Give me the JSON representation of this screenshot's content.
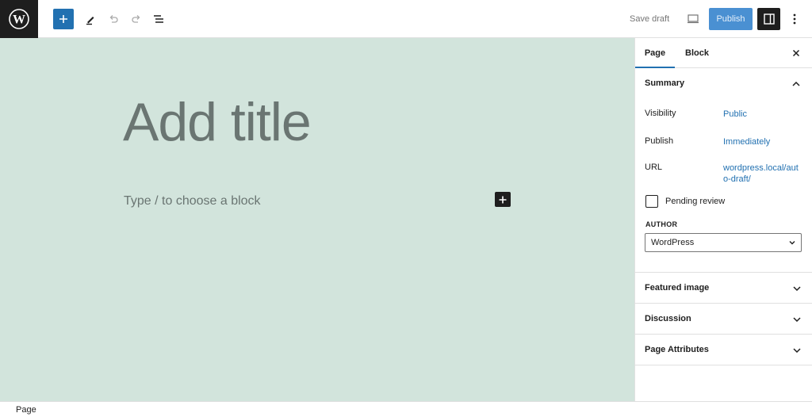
{
  "toolbar": {
    "add_block_label": "+",
    "save_draft": "Save draft",
    "publish": "Publish"
  },
  "editor": {
    "title_placeholder": "Add title",
    "block_placeholder": "Type / to choose a block"
  },
  "sidebar": {
    "tabs": [
      {
        "label": "Page",
        "active": true
      },
      {
        "label": "Block",
        "active": false
      }
    ],
    "summary": {
      "title": "Summary",
      "rows": [
        {
          "label": "Visibility",
          "value": "Public"
        },
        {
          "label": "Publish",
          "value": "Immediately"
        },
        {
          "label": "URL",
          "value": "wordpress.local/auto-draft/"
        }
      ],
      "pending_review_label": "Pending review",
      "pending_review_checked": false,
      "author_label": "AUTHOR",
      "author_value": "WordPress"
    },
    "panels": [
      {
        "label": "Featured image"
      },
      {
        "label": "Discussion"
      },
      {
        "label": "Page Attributes"
      }
    ]
  },
  "footer": {
    "breadcrumb": "Page"
  },
  "colors": {
    "accent": "#2271b1",
    "canvas_bg": "#d2e4dc",
    "dark": "#1e1e1e"
  },
  "icons": [
    "wordpress-logo-icon",
    "plus-icon",
    "pencil-icon",
    "undo-icon",
    "redo-icon",
    "list-view-icon",
    "desktop-preview-icon",
    "sidebar-settings-icon",
    "more-vertical-icon",
    "close-icon",
    "chevron-up-icon",
    "chevron-down-icon"
  ]
}
